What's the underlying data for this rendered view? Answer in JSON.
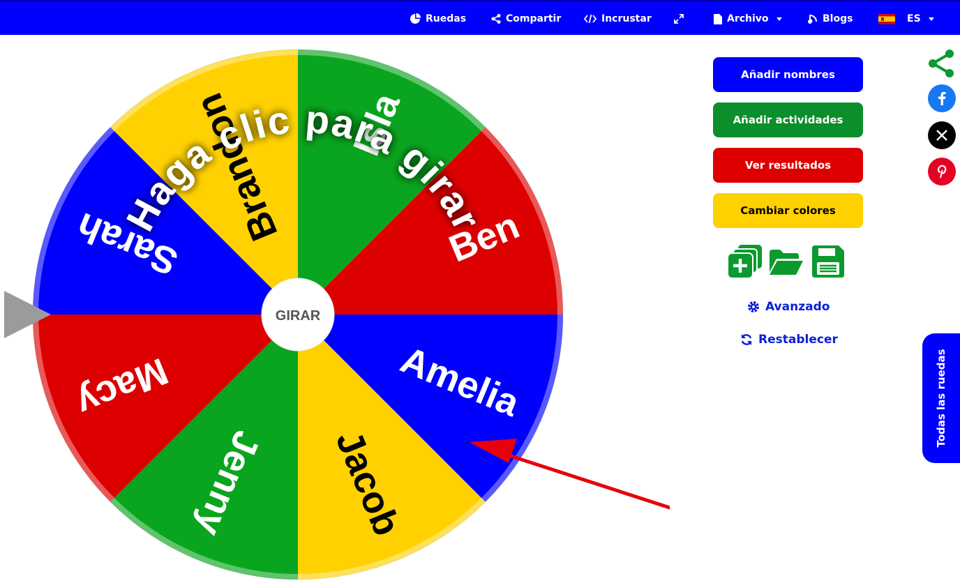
{
  "nav": {
    "ruedas": "Ruedas",
    "compartir": "Compartir",
    "incrustar": "Incrustar",
    "archivo": "Archivo",
    "blogs": "Blogs",
    "lang": "ES"
  },
  "wheel": {
    "overlay_text": "Haga clic para girar",
    "center_label": "GIRAR",
    "segments": [
      {
        "label": "Amelia",
        "color": "#0000ff",
        "text_color": "#ffffff"
      },
      {
        "label": "Jacob",
        "color": "#ffd100",
        "text_color": "#000000"
      },
      {
        "label": "Jenny",
        "color": "#0aa51e",
        "text_color": "#ffffff"
      },
      {
        "label": "Macy",
        "color": "#dd0000",
        "text_color": "#ffffff"
      },
      {
        "label": "Sarah",
        "color": "#0000ff",
        "text_color": "#ffffff"
      },
      {
        "label": "Brandon",
        "color": "#ffd100",
        "text_color": "#000000"
      },
      {
        "label": "Isla",
        "color": "#0aa51e",
        "text_color": "#ffffff"
      },
      {
        "label": "Ben",
        "color": "#dd0000",
        "text_color": "#ffffff"
      }
    ]
  },
  "actions": {
    "add_names": "Añadir nombres",
    "add_activities": "Añadir actividades",
    "view_results": "Ver resultados",
    "change_colors": "Cambiar colores",
    "advanced": "Avanzado",
    "reset": "Restablecer"
  },
  "side_tab": "Todas las ruedas",
  "colors": {
    "brand_blue": "#0000ff",
    "green": "#0a8f2a",
    "red": "#dd0000",
    "yellow": "#ffd100",
    "link_blue": "#0a1fd6",
    "arrow_red": "#e8000a",
    "pointer_gray": "#9b9b9b"
  },
  "icons": [
    "pie-chart-icon",
    "share-icon",
    "code-icon",
    "expand-icon",
    "file-icon",
    "blog-icon",
    "flag-spain-icon",
    "new-wheel-icon",
    "open-folder-icon",
    "save-icon",
    "gear-icon",
    "refresh-icon",
    "facebook-icon",
    "x-icon",
    "pinterest-icon"
  ]
}
